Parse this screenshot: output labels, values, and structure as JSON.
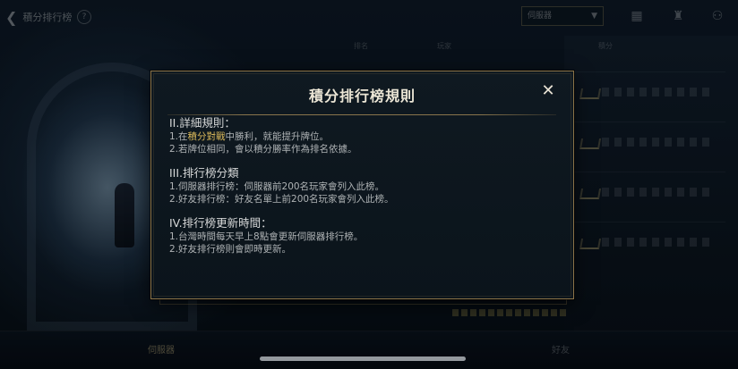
{
  "topbar": {
    "back_label": "積分排行榜",
    "help_glyph": "?",
    "server_select": "伺服器"
  },
  "columns": [
    "排名",
    "玩家",
    "積分"
  ],
  "bottom_tabs": [
    "伺服器",
    "好友"
  ],
  "modal": {
    "title": "積分排行榜規則",
    "close_glyph": "✕",
    "sections": [
      {
        "heading": "II.詳細規則：",
        "lines": [
          {
            "prefix": "1.在",
            "highlight": "積分對戰",
            "suffix": "中勝利，就能提升牌位。"
          },
          {
            "prefix": "2.若牌位相同，會以積分勝率作為排名依據。",
            "highlight": "",
            "suffix": ""
          }
        ]
      },
      {
        "heading": "III.排行榜分類",
        "lines": [
          {
            "prefix": "1.伺服器排行榜：伺服器前200名玩家會列入此榜。",
            "highlight": "",
            "suffix": ""
          },
          {
            "prefix": "2.好友排行榜：好友名單上前200名玩家會列入此榜。",
            "highlight": "",
            "suffix": ""
          }
        ]
      },
      {
        "heading": "IV.排行榜更新時間：",
        "lines": [
          {
            "prefix": "1.台灣時間每天早上8點會更新伺服器排行榜。",
            "highlight": "",
            "suffix": ""
          },
          {
            "prefix": "2.好友排行榜則會即時更新。",
            "highlight": "",
            "suffix": ""
          }
        ]
      }
    ]
  },
  "colors": {
    "border_gold": "#8a7348",
    "highlight_gold": "#d8b75a",
    "title_text": "#ece6d6",
    "body_text": "#aeb2b4"
  }
}
